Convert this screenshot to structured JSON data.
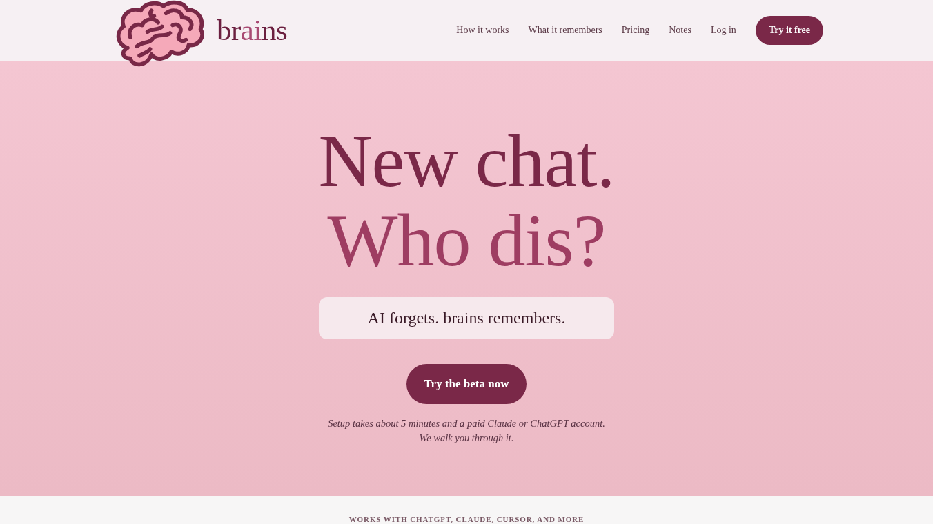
{
  "header": {
    "logo": {
      "parts": [
        {
          "text": "br",
          "kind": "plain"
        },
        {
          "text": "ai",
          "kind": "accent"
        },
        {
          "text": "ns",
          "kind": "plain"
        }
      ]
    },
    "nav": [
      "How it works",
      "What it remembers",
      "Pricing",
      "Notes",
      "Log in"
    ],
    "cta": {
      "label": "Try it free"
    }
  },
  "hero": {
    "headline": [
      {
        "text": "New chat.",
        "kind": "primary"
      },
      {
        "text": "Who dis?",
        "kind": "accent"
      }
    ],
    "tagline": "AI forgets. brains remembers.",
    "cta": {
      "label": "Try the beta now"
    },
    "note": [
      "Setup takes about 5 minutes and a paid Claude or ChatGPT account.",
      "We walk you through it."
    ]
  },
  "compat_strip": {
    "label": "WORKS WITH CHATGPT, CLAUDE, CURSOR, AND MORE"
  }
}
